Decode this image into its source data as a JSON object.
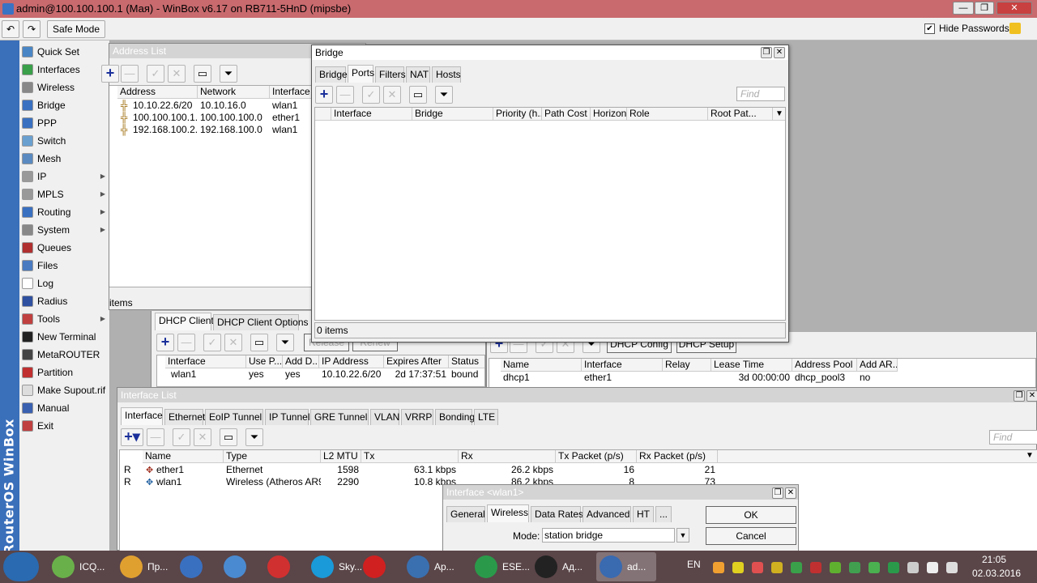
{
  "window": {
    "title": "admin@100.100.100.1 (Мая) - WinBox v6.17 on RB711-5HnD (mipsbe)",
    "min": "—",
    "max": "❐",
    "close": "✕"
  },
  "toolbar": {
    "undo": "↶",
    "redo": "↷",
    "safe_mode": "Safe Mode",
    "hide_passwords": "Hide Passwords",
    "hide_checked": "✔"
  },
  "brand": "RouterOS WinBox",
  "menu": [
    {
      "label": "Quick Set",
      "icon": "quickset-icon",
      "color": "#4a86c5",
      "sub": false
    },
    {
      "label": "Interfaces",
      "icon": "interfaces-icon",
      "color": "#3aa04a",
      "sub": false
    },
    {
      "label": "Wireless",
      "icon": "wireless-icon",
      "color": "#888888",
      "sub": false
    },
    {
      "label": "Bridge",
      "icon": "bridge-icon",
      "color": "#3a70c0",
      "sub": false
    },
    {
      "label": "PPP",
      "icon": "ppp-icon",
      "color": "#3a70c0",
      "sub": false
    },
    {
      "label": "Switch",
      "icon": "switch-icon",
      "color": "#6aa0d0",
      "sub": false
    },
    {
      "label": "Mesh",
      "icon": "mesh-icon",
      "color": "#5a8ac0",
      "sub": false
    },
    {
      "label": "IP",
      "icon": "ip-icon",
      "color": "#999999",
      "sub": true
    },
    {
      "label": "MPLS",
      "icon": "mpls-icon",
      "color": "#999999",
      "sub": true
    },
    {
      "label": "Routing",
      "icon": "routing-icon",
      "color": "#3a70c0",
      "sub": true
    },
    {
      "label": "System",
      "icon": "system-icon",
      "color": "#888888",
      "sub": true
    },
    {
      "label": "Queues",
      "icon": "queues-icon",
      "color": "#b03030",
      "sub": false
    },
    {
      "label": "Files",
      "icon": "files-icon",
      "color": "#4a7ac0",
      "sub": false
    },
    {
      "label": "Log",
      "icon": "log-icon",
      "color": "#ffffff",
      "sub": false
    },
    {
      "label": "Radius",
      "icon": "radius-icon",
      "color": "#3050a0",
      "sub": false
    },
    {
      "label": "Tools",
      "icon": "tools-icon",
      "color": "#c04040",
      "sub": true
    },
    {
      "label": "New Terminal",
      "icon": "terminal-icon",
      "color": "#222222",
      "sub": false
    },
    {
      "label": "MetaROUTER",
      "icon": "metarouter-icon",
      "color": "#444444",
      "sub": false
    },
    {
      "label": "Partition",
      "icon": "partition-icon",
      "color": "#c03030",
      "sub": false
    },
    {
      "label": "Make Supout.rif",
      "icon": "supout-icon",
      "color": "#dddddd",
      "sub": false
    },
    {
      "label": "Manual",
      "icon": "manual-icon",
      "color": "#3a60b0",
      "sub": false
    },
    {
      "label": "Exit",
      "icon": "exit-icon",
      "color": "#c04040",
      "sub": false
    }
  ],
  "address_list": {
    "title": "Address List",
    "headers": [
      "Address",
      "Network",
      "Interface"
    ],
    "rows": [
      [
        "10.10.22.6/20",
        "10.10.16.0",
        "wlan1"
      ],
      [
        "100.100.100.1...",
        "100.100.100.0",
        "ether1"
      ],
      [
        "192.168.100.2...",
        "192.168.100.0",
        "wlan1"
      ]
    ],
    "status": "items"
  },
  "bridge": {
    "title": "Bridge",
    "tabs": [
      "Bridge",
      "Ports",
      "Filters",
      "NAT",
      "Hosts"
    ],
    "find_placeholder": "Find",
    "headers": [
      "Interface",
      "Bridge",
      "Priority (h...",
      "Path Cost",
      "Horizon",
      "Role",
      "Root Pat..."
    ],
    "status": "0 items"
  },
  "dhcp_client": {
    "tabs": [
      "DHCP Client",
      "DHCP Client Options"
    ],
    "buttons": [
      "Release",
      "Renew"
    ],
    "headers": [
      "Interface",
      "Use P...",
      "Add D...",
      "IP Address",
      "Expires After",
      "Status"
    ],
    "rows": [
      [
        "wlan1",
        "yes",
        "yes",
        "10.10.22.6/20",
        "2d 17:37:51",
        "bound"
      ]
    ]
  },
  "dhcp_server": {
    "buttons": [
      "DHCP Config",
      "DHCP Setup"
    ],
    "headers": [
      "Name",
      "Interface",
      "Relay",
      "Lease Time",
      "Address Pool",
      "Add AR..."
    ],
    "rows": [
      [
        "dhcp1",
        "ether1",
        "",
        "3d 00:00:00",
        "dhcp_pool3",
        "no"
      ]
    ]
  },
  "interface_list": {
    "title": "Interface List",
    "tabs": [
      "Interface",
      "Ethernet",
      "EoIP Tunnel",
      "IP Tunnel",
      "GRE Tunnel",
      "VLAN",
      "VRRP",
      "Bonding",
      "LTE"
    ],
    "find_placeholder": "Find",
    "headers": [
      "Name",
      "Type",
      "L2 MTU",
      "Tx",
      "Rx",
      "Tx Packet (p/s)",
      "Rx Packet (p/s)"
    ],
    "rows": [
      [
        "R",
        "ether1",
        "Ethernet",
        "1598",
        "63.1 kbps",
        "26.2 kbps",
        "16",
        "21"
      ],
      [
        "R",
        "wlan1",
        "Wireless (Atheros AR9...",
        "2290",
        "10.8 kbps",
        "86.2 kbps",
        "8",
        "73"
      ]
    ]
  },
  "interface_dialog": {
    "title": "Interface <wlan1>",
    "tabs": [
      "General",
      "Wireless",
      "Data Rates",
      "Advanced",
      "HT",
      "..."
    ],
    "mode_label": "Mode:",
    "mode_value": "station bridge",
    "ok": "OK",
    "cancel": "Cancel"
  },
  "taskbar": {
    "items": [
      {
        "label": "ICQ...",
        "color": "#6ab04a"
      },
      {
        "label": "Пр...",
        "color": "#e0a030"
      },
      {
        "label": "",
        "color": "#3a70c0"
      },
      {
        "label": "",
        "color": "#4a8ad0"
      },
      {
        "label": "",
        "color": "#d03030"
      },
      {
        "label": "Sky...",
        "color": "#1a9ad8"
      },
      {
        "label": "",
        "color": "#d02020"
      },
      {
        "label": "Ар...",
        "color": "#3a70b0"
      },
      {
        "label": "ESE...",
        "color": "#2a9a4a"
      },
      {
        "label": "Ад...",
        "color": "#222222"
      },
      {
        "label": "ad...",
        "color": "#3a6ab0"
      }
    ],
    "lang": "EN",
    "time": "21:05",
    "date": "02.03.2016"
  }
}
